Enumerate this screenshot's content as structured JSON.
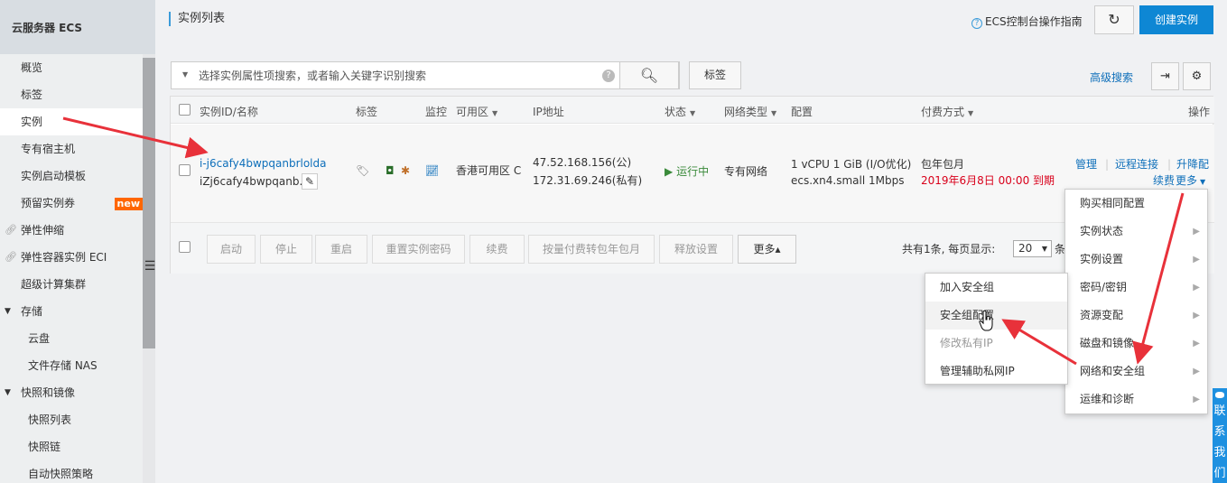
{
  "sidebar": {
    "title": "云服务器 ECS",
    "items": [
      {
        "label": "概览"
      },
      {
        "label": "标签"
      },
      {
        "label": "实例"
      },
      {
        "label": "专有宿主机"
      },
      {
        "label": "实例启动模板"
      },
      {
        "label": "预留实例券",
        "badge": "new"
      },
      {
        "label": "弹性伸缩"
      },
      {
        "label": "弹性容器实例 ECI"
      },
      {
        "label": "超级计算集群"
      },
      {
        "label": "存储"
      },
      {
        "label": "云盘"
      },
      {
        "label": "文件存储 NAS"
      },
      {
        "label": "快照和镜像"
      },
      {
        "label": "快照列表"
      },
      {
        "label": "快照链"
      },
      {
        "label": "自动快照策略"
      }
    ]
  },
  "header": {
    "title": "实例列表",
    "guide_label": "ECS控制台操作指南",
    "create_label": "创建实例"
  },
  "search": {
    "placeholder": "选择实例属性项搜索，或者输入关键字识别搜索",
    "tag_label": "标签",
    "advanced_label": "高级搜索"
  },
  "table": {
    "columns": {
      "id": "实例ID/名称",
      "tags": "标签",
      "monitor": "监控",
      "zone": "可用区",
      "ip": "IP地址",
      "status": "状态",
      "network": "网络类型",
      "config": "配置",
      "billing": "付费方式",
      "actions": "操作"
    },
    "rows": [
      {
        "id": "i-j6cafy4bwpqanbrlolda",
        "name": "iZj6cafy4bwpqanb...",
        "zone": "香港可用区 C",
        "ip_public": "47.52.168.156(公)",
        "ip_private": "172.31.69.246(私有)",
        "status": "运行中",
        "network": "专有网络",
        "config_line1": "1 vCPU 1 GiB (I/O优化)",
        "config_line2": "ecs.xn4.small   1Mbps",
        "billing_type": "包年包月",
        "expiry": "2019年6月8日 00:00 到期",
        "actions": {
          "manage": "管理",
          "remote": "远程连接",
          "upgrade": "升降配",
          "renew": "续费",
          "more": "更多"
        }
      }
    ]
  },
  "footer": {
    "buttons": [
      "启动",
      "停止",
      "重启",
      "重置实例密码",
      "续费",
      "按量付费转包年包月",
      "释放设置"
    ],
    "more_label": "更多▴",
    "pager_text": "共有1条, 每页显示:",
    "page_size": "20",
    "pager_unit": "条"
  },
  "more_menu": {
    "items": [
      {
        "label": "购买相同配置",
        "submenu": false
      },
      {
        "label": "实例状态",
        "submenu": true
      },
      {
        "label": "实例设置",
        "submenu": true
      },
      {
        "label": "密码/密钥",
        "submenu": true
      },
      {
        "label": "资源变配",
        "submenu": true
      },
      {
        "label": "磁盘和镜像",
        "submenu": true
      },
      {
        "label": "网络和安全组",
        "submenu": true
      },
      {
        "label": "运维和诊断",
        "submenu": true
      }
    ]
  },
  "security_submenu": {
    "items": [
      {
        "label": "加入安全组",
        "state": "normal"
      },
      {
        "label": "安全组配置",
        "state": "hover"
      },
      {
        "label": "修改私有IP",
        "state": "disabled"
      },
      {
        "label": "管理辅助私网IP",
        "state": "normal"
      }
    ]
  },
  "contact": {
    "label": "联系我们"
  },
  "colors": {
    "primary": "#0e87d4",
    "link": "#0e6fba",
    "running": "#3a8a3a",
    "expiry": "#d9001b",
    "annotation_arrow": "#e8313a"
  }
}
